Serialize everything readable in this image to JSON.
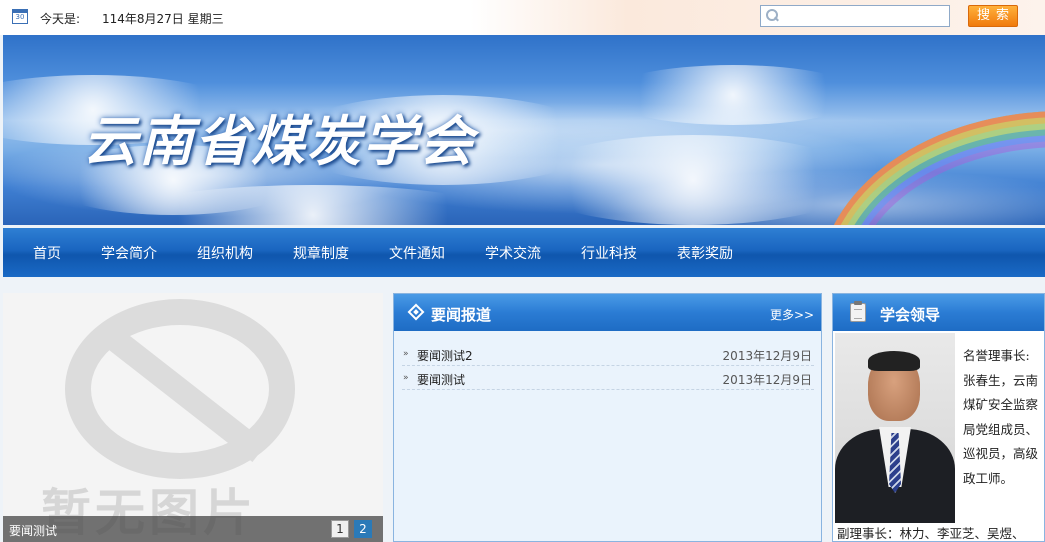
{
  "topbar": {
    "calendar_icon": "calendar-icon",
    "calendar_day": "30",
    "date_label": "今天是:",
    "date_value": "114年8月27日 星期三",
    "search": {
      "value": "",
      "placeholder": "",
      "icon": "search-icon",
      "button_label": "搜索"
    }
  },
  "banner": {
    "title": "云南省煤炭学会"
  },
  "nav": {
    "items": [
      {
        "label": "首页"
      },
      {
        "label": "学会简介"
      },
      {
        "label": "组织机构"
      },
      {
        "label": "规章制度"
      },
      {
        "label": "文件通知"
      },
      {
        "label": "学术交流"
      },
      {
        "label": "行业科技"
      },
      {
        "label": "表彰奖励"
      }
    ]
  },
  "slider": {
    "placeholder_text": "暂无图片",
    "caption": "要闻测试",
    "pages": [
      "1",
      "2"
    ],
    "active_page": "2"
  },
  "news": {
    "title": "要闻报道",
    "more": "更多>>",
    "items": [
      {
        "title": "要闻测试2",
        "date": "2013年12月9日"
      },
      {
        "title": "要闻测试",
        "date": "2013年12月9日"
      }
    ]
  },
  "leader": {
    "title": "学会领导",
    "text": "名誉理事长:张春生，云南煤矿安全监察局党组成员、巡视员，高级政工师。",
    "text2": "副理事长：林力、李亚芝、吴煜、"
  },
  "colors": {
    "nav_blue": "#1a65c0",
    "search_orange": "#f07a0c",
    "panel_header_blue": "#2b7cd4"
  }
}
